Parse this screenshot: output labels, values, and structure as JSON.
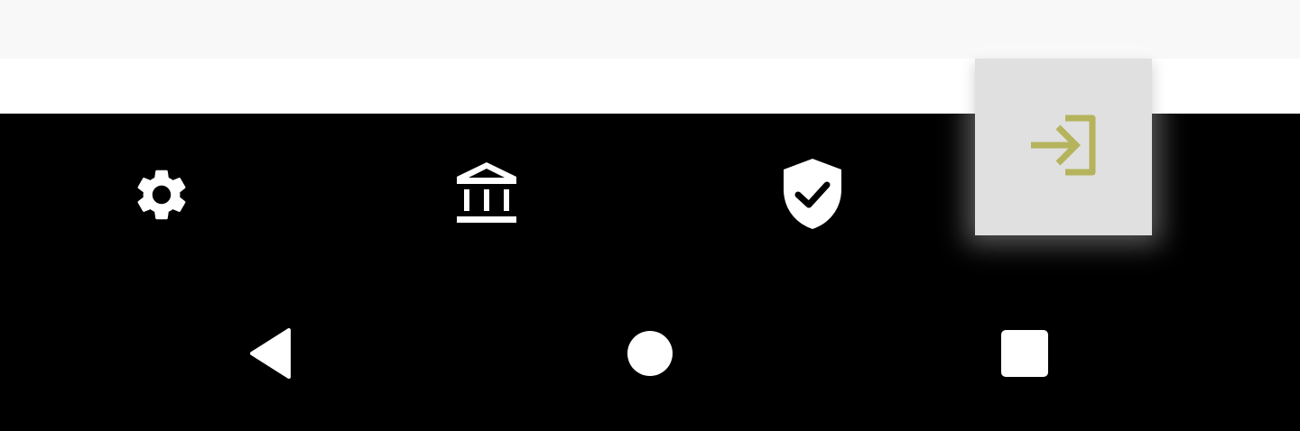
{
  "colors": {
    "top_strip": "#f8f8f8",
    "white_strip": "#ffffff",
    "nav_background": "#000000",
    "nav_icon": "#ffffff",
    "fab_background": "#e0e0e0",
    "fab_icon": "#b5b35c"
  },
  "bottom_nav": {
    "items": [
      {
        "icon": "gear-icon"
      },
      {
        "icon": "bank-icon"
      },
      {
        "icon": "shield-check-icon"
      }
    ]
  },
  "login_button": {
    "icon": "login-icon"
  },
  "system_nav": {
    "buttons": [
      {
        "icon": "back-triangle-icon"
      },
      {
        "icon": "home-circle-icon"
      },
      {
        "icon": "recents-square-icon"
      }
    ]
  }
}
